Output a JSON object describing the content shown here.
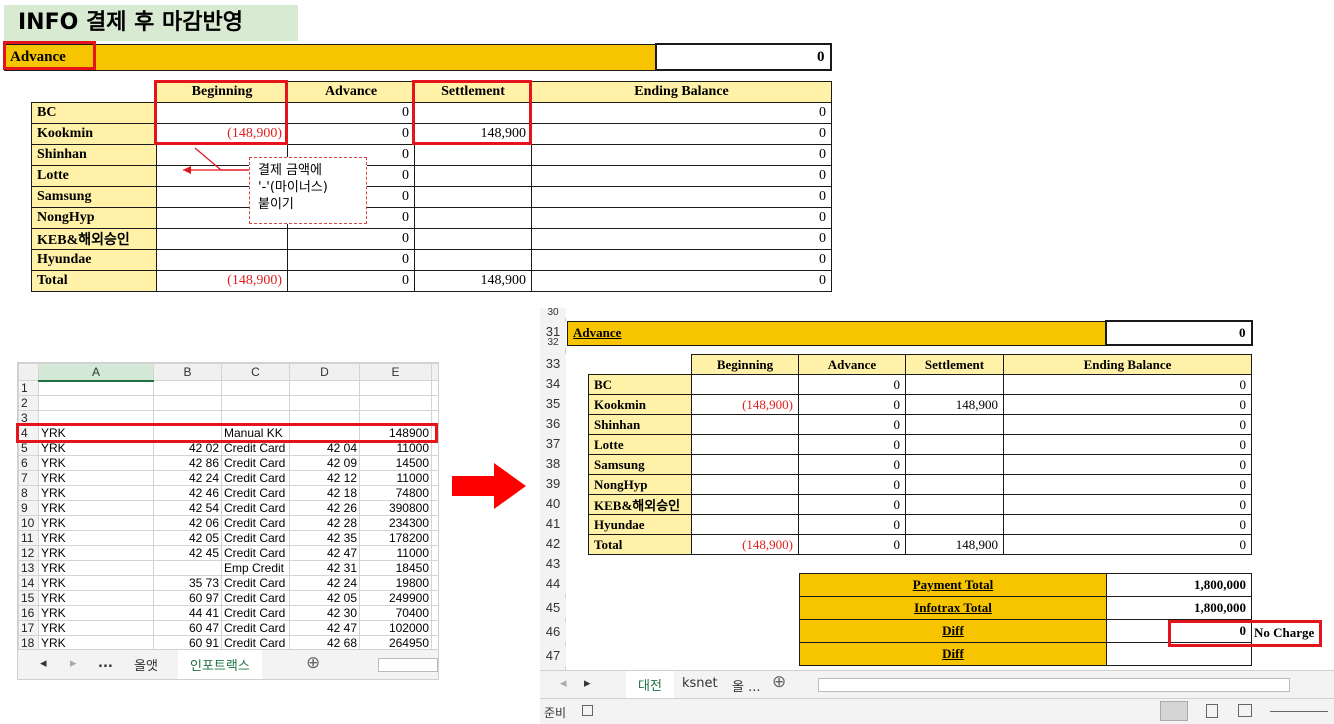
{
  "title": "INFO 결제 후 마감반영",
  "top": {
    "advance_label": "Advance",
    "advance_value": "0",
    "headers": [
      "Beginning",
      "Advance",
      "Settlement",
      "Ending Balance"
    ],
    "rows": [
      {
        "name": "BC",
        "beginning": "",
        "advance": "0",
        "settlement": "",
        "ending": "0"
      },
      {
        "name": "Kookmin",
        "beginning": "(148,900)",
        "advance": "0",
        "settlement": "148,900",
        "ending": "0"
      },
      {
        "name": "Shinhan",
        "beginning": "",
        "advance": "0",
        "settlement": "",
        "ending": "0"
      },
      {
        "name": "Lotte",
        "beginning": "",
        "advance": "0",
        "settlement": "",
        "ending": "0"
      },
      {
        "name": "Samsung",
        "beginning": "",
        "advance": "0",
        "settlement": "",
        "ending": "0"
      },
      {
        "name": "NongHyp",
        "beginning": "",
        "advance": "0",
        "settlement": "",
        "ending": "0"
      },
      {
        "name": "KEB&해외승인",
        "beginning": "",
        "advance": "0",
        "settlement": "",
        "ending": "0"
      },
      {
        "name": "Hyundae",
        "beginning": "",
        "advance": "0",
        "settlement": "",
        "ending": "0"
      },
      {
        "name": "Total",
        "beginning": "(148,900)",
        "advance": "0",
        "settlement": "148,900",
        "ending": "0"
      }
    ],
    "callout_lines": [
      "결제 금액에",
      "'-'(마이너스)",
      "붙이기"
    ]
  },
  "grid": {
    "columns": [
      "A",
      "B",
      "C",
      "D",
      "E"
    ],
    "rows": [
      {
        "n": "1",
        "a": "",
        "b": "",
        "c": "",
        "d": "",
        "e": ""
      },
      {
        "n": "2",
        "a": "",
        "b": "",
        "c": "",
        "d": "",
        "e": ""
      },
      {
        "n": "3",
        "a": "",
        "b": "",
        "c": "",
        "d": "",
        "e": ""
      },
      {
        "n": "4",
        "a": "YRK",
        "b": "",
        "c": "Manual KK",
        "d": "",
        "e": "148900"
      },
      {
        "n": "5",
        "a": "YRK",
        "b": "42 02",
        "c": "Credit Card",
        "d": "42 04",
        "e": "11000"
      },
      {
        "n": "6",
        "a": "YRK",
        "b": "42 86",
        "c": "Credit Card",
        "d": "42 09",
        "e": "14500"
      },
      {
        "n": "7",
        "a": "YRK",
        "b": "42 24",
        "c": "Credit Card",
        "d": "42 12",
        "e": "11000"
      },
      {
        "n": "8",
        "a": "YRK",
        "b": "42 46",
        "c": "Credit Card",
        "d": "42 18",
        "e": "74800"
      },
      {
        "n": "9",
        "a": "YRK",
        "b": "42 54",
        "c": "Credit Card",
        "d": "42 26",
        "e": "390800"
      },
      {
        "n": "10",
        "a": "YRK",
        "b": "42 06",
        "c": "Credit Card",
        "d": "42 28",
        "e": "234300"
      },
      {
        "n": "11",
        "a": "YRK",
        "b": "42 05",
        "c": "Credit Card",
        "d": "42 35",
        "e": "178200"
      },
      {
        "n": "12",
        "a": "YRK",
        "b": "42 45",
        "c": "Credit Card",
        "d": "42 47",
        "e": "11000"
      },
      {
        "n": "13",
        "a": "YRK",
        "b": "",
        "c": "Emp Credit",
        "d": "42 31",
        "e": "18450"
      },
      {
        "n": "14",
        "a": "YRK",
        "b": "35 73",
        "c": "Credit Card",
        "d": "42 24",
        "e": "19800"
      },
      {
        "n": "15",
        "a": "YRK",
        "b": "60 97",
        "c": "Credit Card",
        "d": "42 05",
        "e": "249900"
      },
      {
        "n": "16",
        "a": "YRK",
        "b": "44 41",
        "c": "Credit Card",
        "d": "42 30",
        "e": "70400"
      },
      {
        "n": "17",
        "a": "YRK",
        "b": "60 47",
        "c": "Credit Card",
        "d": "42 47",
        "e": "102000"
      },
      {
        "n": "18",
        "a": "YRK",
        "b": "60 91",
        "c": "Credit Card",
        "d": "42 68",
        "e": "264950"
      }
    ],
    "tabs": {
      "prev": "◂",
      "next": "▸",
      "more": "...",
      "tab1": "올앳",
      "tab2": "인포트랙스",
      "add": "⊕"
    }
  },
  "right": {
    "row_numbers": [
      "30",
      "31",
      "32",
      "33",
      "34",
      "35",
      "36",
      "37",
      "38",
      "39",
      "40",
      "41",
      "42",
      "43",
      "44",
      "45",
      "46",
      "47"
    ],
    "advance_label": "Advance",
    "advance_value": "0",
    "headers": [
      "Beginning",
      "Advance",
      "Settlement",
      "Ending Balance"
    ],
    "rows": [
      {
        "name": "BC",
        "beginning": "",
        "advance": "0",
        "settlement": "",
        "ending": "0"
      },
      {
        "name": "Kookmin",
        "beginning": "(148,900)",
        "advance": "0",
        "settlement": "148,900",
        "ending": "0"
      },
      {
        "name": "Shinhan",
        "beginning": "",
        "advance": "0",
        "settlement": "",
        "ending": "0"
      },
      {
        "name": "Lotte",
        "beginning": "",
        "advance": "0",
        "settlement": "",
        "ending": "0"
      },
      {
        "name": "Samsung",
        "beginning": "",
        "advance": "0",
        "settlement": "",
        "ending": "0"
      },
      {
        "name": "NongHyp",
        "beginning": "",
        "advance": "0",
        "settlement": "",
        "ending": "0"
      },
      {
        "name": "KEB&해외승인",
        "beginning": "",
        "advance": "0",
        "settlement": "",
        "ending": "0"
      },
      {
        "name": "Hyundae",
        "beginning": "",
        "advance": "0",
        "settlement": "",
        "ending": "0"
      },
      {
        "name": "Total",
        "beginning": "(148,900)",
        "advance": "0",
        "settlement": "148,900",
        "ending": "0"
      }
    ],
    "summary": [
      {
        "label": "Payment Total",
        "value": "1,800,000"
      },
      {
        "label": "Infotrax Total",
        "value": "1,800,000"
      },
      {
        "label": "Diff",
        "value": "0"
      },
      {
        "label": "Diff",
        "value": ""
      }
    ],
    "no_charge": "No Charge",
    "tabs": {
      "tab1": "대전",
      "tab2": "ksnet",
      "tab3": "올 ...",
      "add": "⊕"
    },
    "status_ready": "준비"
  },
  "colors": {
    "accent_red": "#e3141b",
    "gold": "#f7c400",
    "light_yellow": "#fff2a8",
    "excel_green": "#217346"
  }
}
